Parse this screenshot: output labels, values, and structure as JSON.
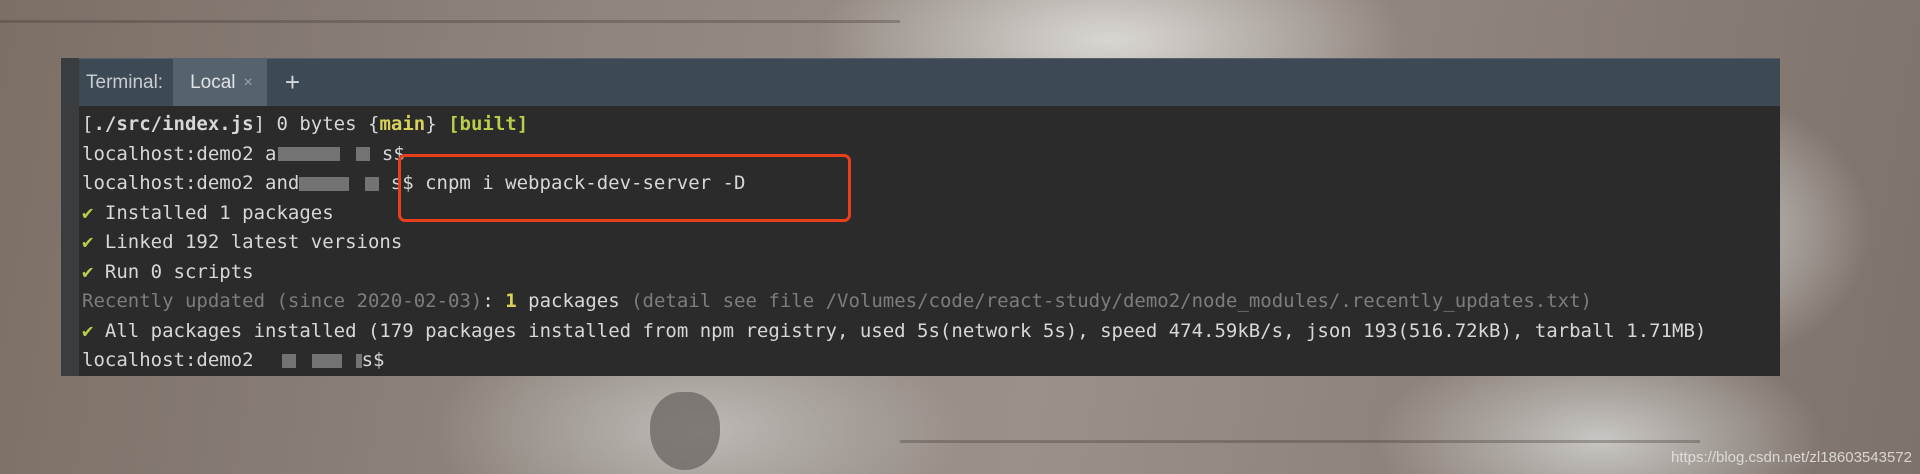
{
  "terminal": {
    "tab_title": "Terminal:",
    "tab_local": "Local",
    "tab_close": "×",
    "tab_add": "+"
  },
  "lines": {
    "l1_a": "[",
    "l1_b": "./src/index.js",
    "l1_c": "] 0 bytes {",
    "l1_d": "main",
    "l1_e": "} ",
    "l1_f": "[built]",
    "l2_prompt": "localhost:demo2 a",
    "l2_end": " s$",
    "l3_prompt": "localhost:demo2 and",
    "l3_end": " s$",
    "l3_cmd": " cnpm i webpack-dev-server -D",
    "check": "✔",
    "l4": " Installed 1 packages",
    "l5": " Linked 192 latest versions",
    "l6": " Run 0 scripts",
    "l7_a": "Recently updated (since 2020-02-03)",
    "l7_b": ": ",
    "l7_c": "1",
    "l7_d": " packages",
    "l7_e": " (detail see file /Volumes/code/react-study/demo2/node_modules/.recently_updates.txt)",
    "l8": " All packages installed (179 packages installed from npm registry, used 5s(network 5s), speed 474.59kB/s, json 193(516.72kB), tarball 1.71MB)",
    "l9_prompt": "localhost:demo2",
    "l9_end": "s$"
  },
  "watermark": "https://blog.csdn.net/zl18603543572",
  "colors": {
    "highlight_border": "#e8401c",
    "check_green": "#b7cf4b",
    "main_yellow": "#d8d25a"
  }
}
